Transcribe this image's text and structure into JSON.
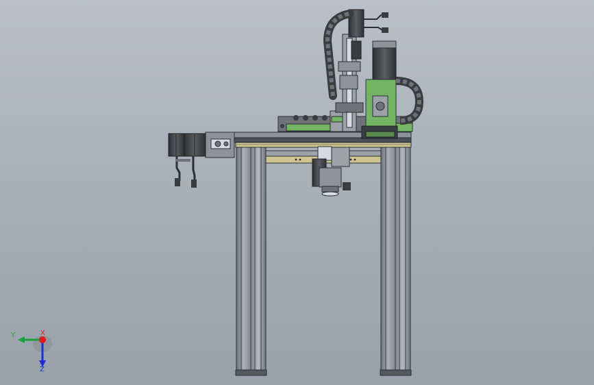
{
  "viewport": {
    "background_top": "#b9c0c9",
    "background_bottom": "#99a1ab"
  },
  "colors": {
    "frame_gray": "#8d939a",
    "frame_dark": "#2b2f33",
    "plate_tan": "#cfc592",
    "plate_green": "#73b565",
    "motor_dark": "#3a3d40",
    "chain_gray": "#6f7378"
  },
  "triad": {
    "y_label": "Y",
    "x_label": "X",
    "z_label": "Z",
    "y_color": "#19a13a",
    "x_color": "#e01b1b",
    "z_color": "#1b2fd6"
  }
}
